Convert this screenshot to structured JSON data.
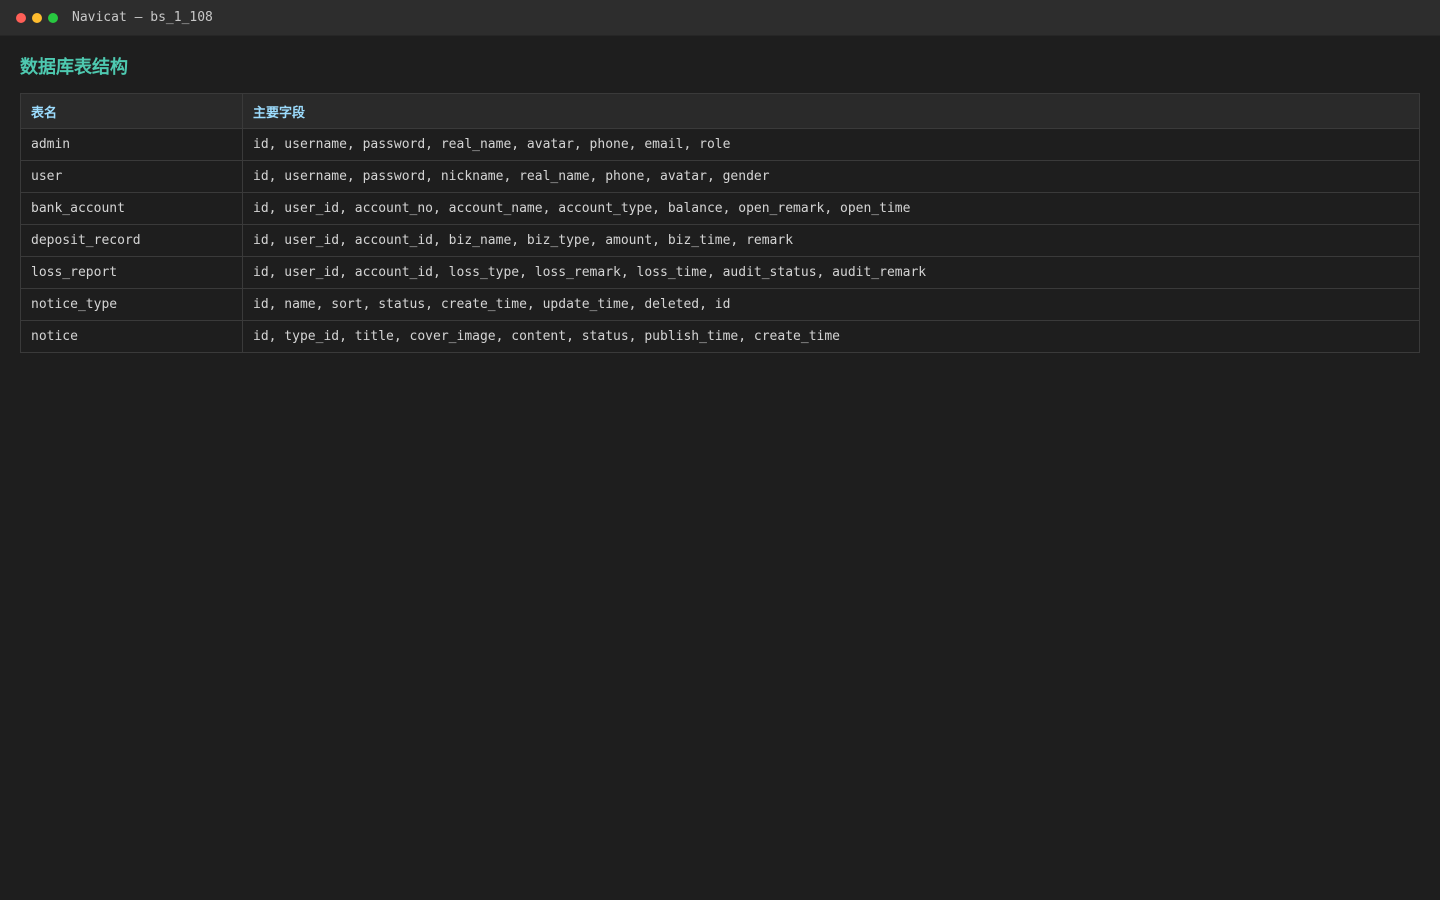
{
  "window": {
    "title": "Navicat — bs_1_108"
  },
  "page": {
    "title": "数据库表结构"
  },
  "table": {
    "headers": [
      "表名",
      "主要字段"
    ],
    "rows": [
      {
        "name": "admin",
        "fields": "id, username, password, real_name, avatar, phone, email, role"
      },
      {
        "name": "user",
        "fields": "id, username, password, nickname, real_name, phone, avatar, gender"
      },
      {
        "name": "bank_account",
        "fields": "id, user_id, account_no, account_name, account_type, balance, open_remark, open_time"
      },
      {
        "name": "deposit_record",
        "fields": "id, user_id, account_id, biz_name, biz_type, amount, biz_time, remark"
      },
      {
        "name": "loss_report",
        "fields": "id, user_id, account_id, loss_type, loss_remark, loss_time, audit_status, audit_remark"
      },
      {
        "name": "notice_type",
        "fields": "id, name, sort, status, create_time, update_time, deleted, id"
      },
      {
        "name": "notice",
        "fields": "id, type_id, title, cover_image, content, status, publish_time, create_time"
      }
    ]
  },
  "colors": {
    "accent": "#4ec9b0",
    "header_text": "#9cdcfe",
    "background": "#1e1e1e"
  }
}
